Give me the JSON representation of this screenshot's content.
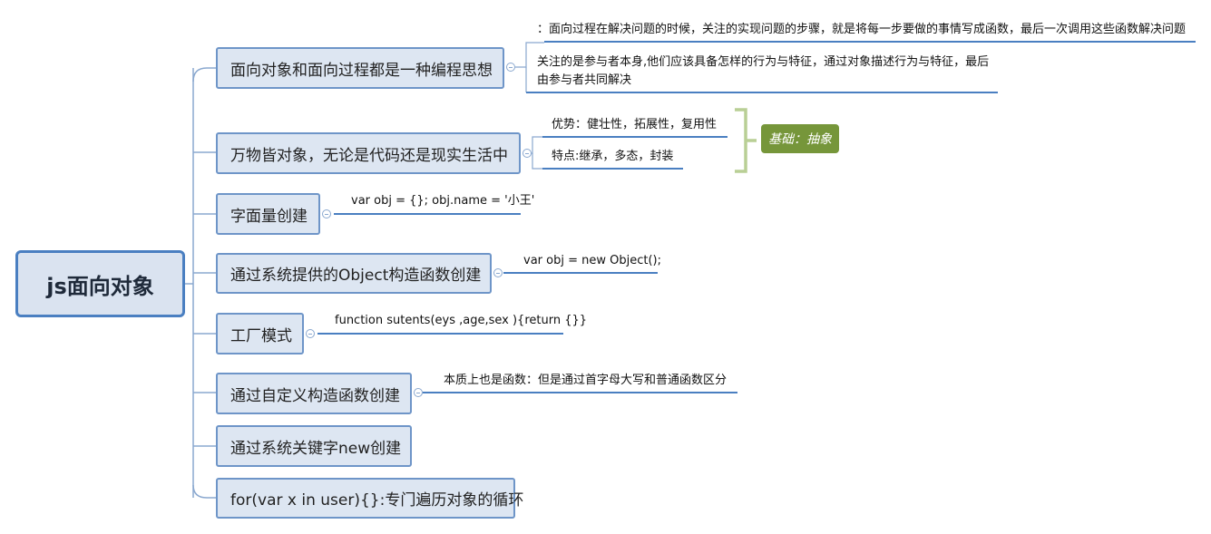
{
  "root": {
    "label": "js面向对象"
  },
  "topics": [
    {
      "label": "面向对象和面向过程都是一种编程思想",
      "children": [
        "：面向过程在解决问题的时候，关注的实现问题的步骤，就是将每一步要做的事情写成函数，最后一次调用这些函数解决问题",
        "关注的是参与者本身,他们应该具备怎样的行为与特征，通过对象描述行为与特征，最后由参与者共同解决"
      ]
    },
    {
      "label": "万物皆对象，无论是代码还是现实生活中",
      "children": [
        "优势：健壮性，拓展性，复用性",
        "特点:继承，多态，封装"
      ],
      "summary": "基础：抽象"
    },
    {
      "label": "字面量创建",
      "children": [
        "var obj = {}; obj.name = '小王'"
      ]
    },
    {
      "label": "通过系统提供的Object构造函数创建",
      "children": [
        "var obj = new Object();"
      ]
    },
    {
      "label": "工厂模式",
      "children": [
        "function sutents(eys ,age,sex ){return {}}"
      ]
    },
    {
      "label": "通过自定义构造函数创建",
      "children": [
        "本质上也是函数：但是通过首字母大写和普通函数区分"
      ]
    },
    {
      "label": "通过系统关键字new创建",
      "children": []
    },
    {
      "label": "for(var x in user){}:专门遍历对象的循环",
      "children": []
    }
  ],
  "colors": {
    "line": "#4a7fc1",
    "branch": "#8aa8cf",
    "bracket": "#b9cf95",
    "summary": "#76963a"
  }
}
